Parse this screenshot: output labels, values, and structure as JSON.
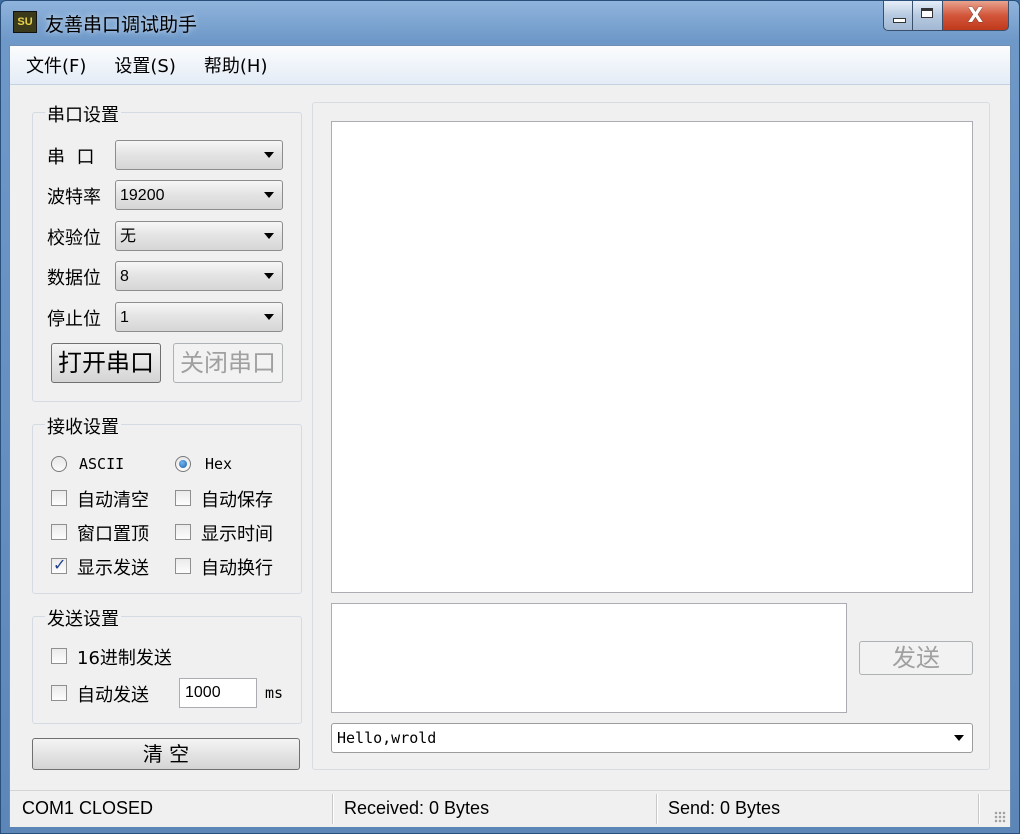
{
  "window": {
    "app_icon": "SU",
    "title": "友善串口调试助手",
    "close_glyph": "X"
  },
  "menu": [
    {
      "label": "文件(F)"
    },
    {
      "label": "设置(S)"
    },
    {
      "label": "帮助(H)"
    }
  ],
  "serial_settings": {
    "title": "串口设置",
    "port_label": "串  口",
    "port_value": "",
    "baud_label": "波特率",
    "baud_value": "19200",
    "parity_label": "校验位",
    "parity_value": "无",
    "databits_label": "数据位",
    "databits_value": "8",
    "stopbits_label": "停止位",
    "stopbits_value": "1",
    "open_button": "打开串口",
    "close_button": "关闭串口"
  },
  "receive_settings": {
    "title": "接收设置",
    "ascii_label": "ASCII",
    "hex_label": "Hex",
    "mode_selected": "Hex",
    "auto_clear": {
      "label": "自动清空",
      "checked": false
    },
    "auto_save": {
      "label": "自动保存",
      "checked": false
    },
    "window_top": {
      "label": "窗口置顶",
      "checked": false
    },
    "show_time": {
      "label": "显示时间",
      "checked": false
    },
    "show_send": {
      "label": "显示发送",
      "checked": true
    },
    "auto_newline": {
      "label": "自动换行",
      "checked": false
    }
  },
  "send_settings": {
    "title": "发送设置",
    "hex_send": {
      "label": "16进制发送",
      "checked": false
    },
    "auto_send": {
      "label": "自动发送",
      "checked": false
    },
    "interval_value": "1000",
    "interval_unit": "ms"
  },
  "clear_button": "清 空",
  "send_button": "发送",
  "send_history_value": "Hello,wrold",
  "status": {
    "port": "COM1 CLOSED",
    "received": "Received: 0 Bytes",
    "sent": "Send: 0 Bytes"
  }
}
